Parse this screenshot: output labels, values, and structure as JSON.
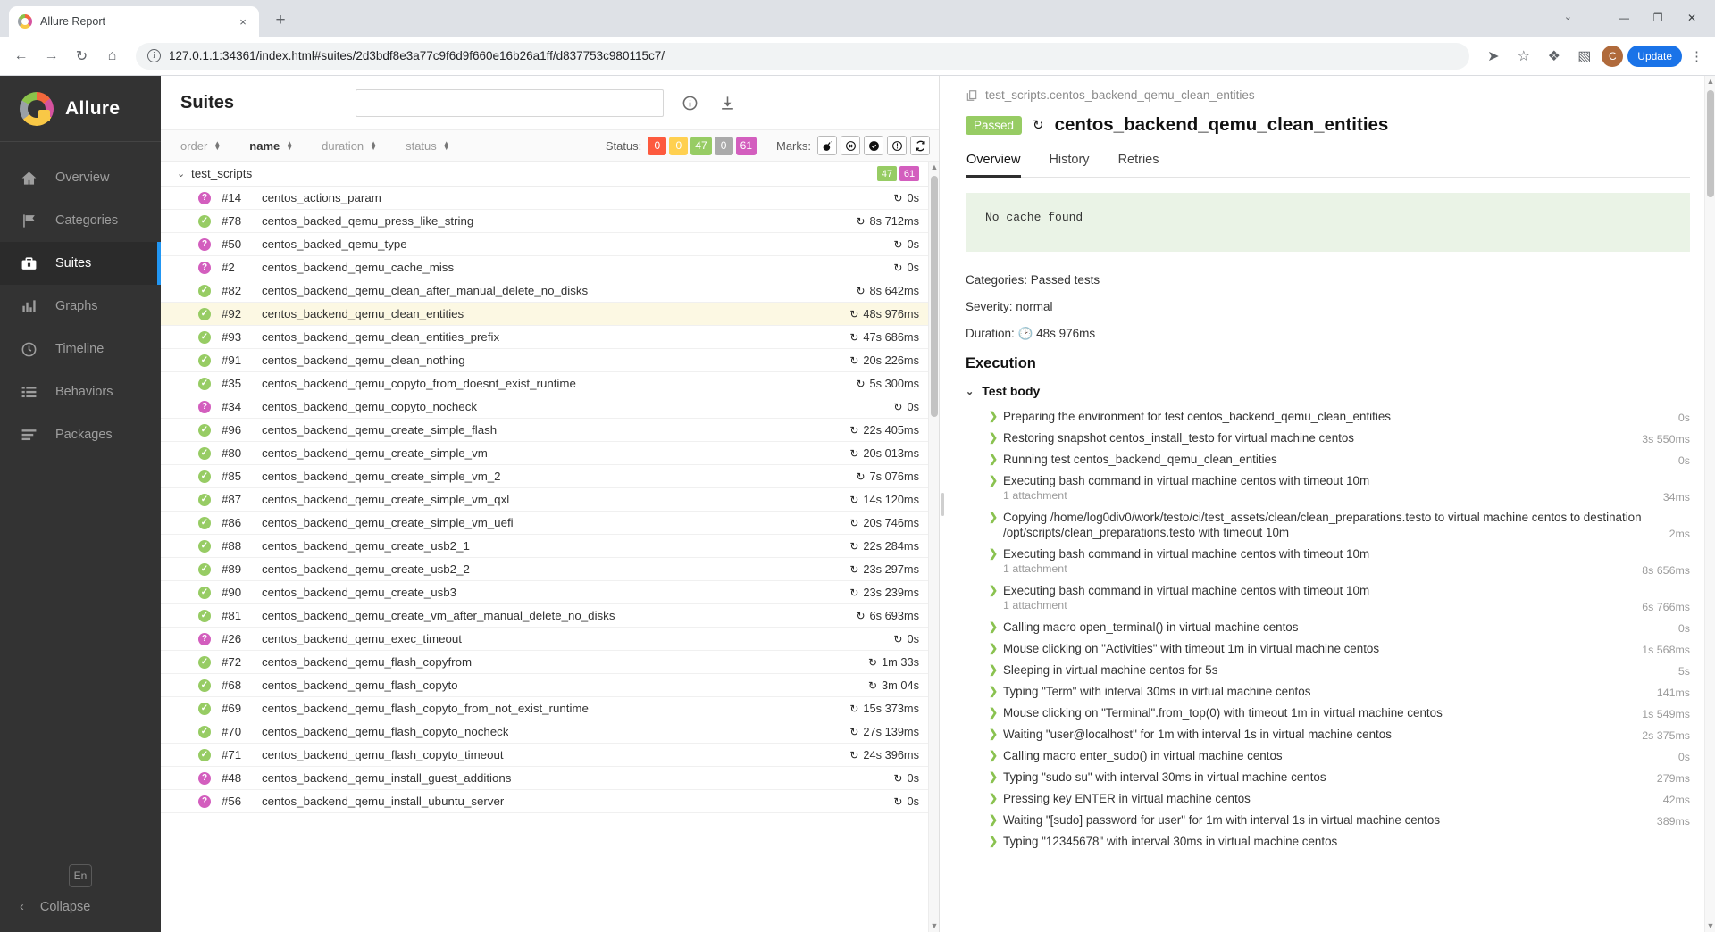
{
  "browser": {
    "tab_title": "Allure Report",
    "tab_close": "×",
    "new_tab": "+",
    "tab_list_chevron": "⌄",
    "url": "127.0.1.1:34361/index.html#suites/2d3bdf8e3a77c9f6d9f660e16b26a1ff/d837753c980115c7/",
    "nav": {
      "back": "←",
      "forward": "→",
      "reload": "↻",
      "home": "⌂",
      "info": "i"
    },
    "right": {
      "share": "➤",
      "bookmark": "☆",
      "extensions": "❖",
      "sidepanel": "▧",
      "profile_initial": "C",
      "update_label": "Update",
      "menu": "⋮"
    },
    "window": {
      "minimize": "—",
      "maximize": "❐",
      "close": "✕"
    }
  },
  "sidebar": {
    "brand": "Allure",
    "items": [
      {
        "label": "Overview",
        "icon": "home-icon",
        "active": false
      },
      {
        "label": "Categories",
        "icon": "flag-icon",
        "active": false
      },
      {
        "label": "Suites",
        "icon": "suitcase-icon",
        "active": true
      },
      {
        "label": "Graphs",
        "icon": "bar-chart-icon",
        "active": false
      },
      {
        "label": "Timeline",
        "icon": "clock-icon",
        "active": false
      },
      {
        "label": "Behaviors",
        "icon": "list-icon",
        "active": false
      },
      {
        "label": "Packages",
        "icon": "layers-icon",
        "active": false
      }
    ],
    "language": "En",
    "collapse": "Collapse",
    "collapse_chevron": "‹"
  },
  "suites": {
    "title": "Suites",
    "search_value": "",
    "search_placeholder": "",
    "info_icon": "info-icon",
    "download_icon": "download-icon",
    "sorters": [
      {
        "label": "order",
        "active": false
      },
      {
        "label": "name",
        "active": true
      },
      {
        "label": "duration",
        "active": false
      },
      {
        "label": "status",
        "active": false
      }
    ],
    "status_label": "Status:",
    "status_chips": [
      {
        "value": "0",
        "color": "#fd5a3e",
        "name": "failed"
      },
      {
        "value": "0",
        "color": "#ffd050",
        "name": "broken"
      },
      {
        "value": "47",
        "color": "#97cc64",
        "name": "passed"
      },
      {
        "value": "0",
        "color": "#aaaaaa",
        "name": "skipped"
      },
      {
        "value": "61",
        "color": "#d35ebe",
        "name": "unknown"
      }
    ],
    "marks_label": "Marks:",
    "marks": [
      {
        "name": "flaky-bomb-icon"
      },
      {
        "name": "new-failed-icon"
      },
      {
        "name": "new-passed-icon"
      },
      {
        "name": "new-broken-icon"
      },
      {
        "name": "retries-icon"
      }
    ],
    "group": {
      "name": "test_scripts",
      "caret": "⌄",
      "chips": [
        {
          "value": "47",
          "color": "#97cc64"
        },
        {
          "value": "61",
          "color": "#d35ebe"
        }
      ]
    },
    "rows": [
      {
        "status": "unknown",
        "num": "#14",
        "name": "centos_actions_param",
        "dur": "0s",
        "retry": true
      },
      {
        "status": "passed",
        "num": "#78",
        "name": "centos_backed_qemu_press_like_string",
        "dur": "8s 712ms",
        "retry": true
      },
      {
        "status": "unknown",
        "num": "#50",
        "name": "centos_backed_qemu_type",
        "dur": "0s",
        "retry": true
      },
      {
        "status": "unknown",
        "num": "#2",
        "name": "centos_backend_qemu_cache_miss",
        "dur": "0s",
        "retry": true
      },
      {
        "status": "passed",
        "num": "#82",
        "name": "centos_backend_qemu_clean_after_manual_delete_no_disks",
        "dur": "8s 642ms",
        "retry": true
      },
      {
        "status": "passed",
        "num": "#92",
        "name": "centos_backend_qemu_clean_entities",
        "dur": "48s 976ms",
        "retry": true,
        "selected": true
      },
      {
        "status": "passed",
        "num": "#93",
        "name": "centos_backend_qemu_clean_entities_prefix",
        "dur": "47s 686ms",
        "retry": true
      },
      {
        "status": "passed",
        "num": "#91",
        "name": "centos_backend_qemu_clean_nothing",
        "dur": "20s 226ms",
        "retry": true
      },
      {
        "status": "passed",
        "num": "#35",
        "name": "centos_backend_qemu_copyto_from_doesnt_exist_runtime",
        "dur": "5s 300ms",
        "retry": true
      },
      {
        "status": "unknown",
        "num": "#34",
        "name": "centos_backend_qemu_copyto_nocheck",
        "dur": "0s",
        "retry": true
      },
      {
        "status": "passed",
        "num": "#96",
        "name": "centos_backend_qemu_create_simple_flash",
        "dur": "22s 405ms",
        "retry": true
      },
      {
        "status": "passed",
        "num": "#80",
        "name": "centos_backend_qemu_create_simple_vm",
        "dur": "20s 013ms",
        "retry": true
      },
      {
        "status": "passed",
        "num": "#85",
        "name": "centos_backend_qemu_create_simple_vm_2",
        "dur": "7s 076ms",
        "retry": true
      },
      {
        "status": "passed",
        "num": "#87",
        "name": "centos_backend_qemu_create_simple_vm_qxl",
        "dur": "14s 120ms",
        "retry": true
      },
      {
        "status": "passed",
        "num": "#86",
        "name": "centos_backend_qemu_create_simple_vm_uefi",
        "dur": "20s 746ms",
        "retry": true
      },
      {
        "status": "passed",
        "num": "#88",
        "name": "centos_backend_qemu_create_usb2_1",
        "dur": "22s 284ms",
        "retry": true
      },
      {
        "status": "passed",
        "num": "#89",
        "name": "centos_backend_qemu_create_usb2_2",
        "dur": "23s 297ms",
        "retry": true
      },
      {
        "status": "passed",
        "num": "#90",
        "name": "centos_backend_qemu_create_usb3",
        "dur": "23s 239ms",
        "retry": true
      },
      {
        "status": "passed",
        "num": "#81",
        "name": "centos_backend_qemu_create_vm_after_manual_delete_no_disks",
        "dur": "6s 693ms",
        "retry": true
      },
      {
        "status": "unknown",
        "num": "#26",
        "name": "centos_backend_qemu_exec_timeout",
        "dur": "0s",
        "retry": true
      },
      {
        "status": "passed",
        "num": "#72",
        "name": "centos_backend_qemu_flash_copyfrom",
        "dur": "1m 33s",
        "retry": true
      },
      {
        "status": "passed",
        "num": "#68",
        "name": "centos_backend_qemu_flash_copyto",
        "dur": "3m 04s",
        "retry": true
      },
      {
        "status": "passed",
        "num": "#69",
        "name": "centos_backend_qemu_flash_copyto_from_not_exist_runtime",
        "dur": "15s 373ms",
        "retry": true
      },
      {
        "status": "passed",
        "num": "#70",
        "name": "centos_backend_qemu_flash_copyto_nocheck",
        "dur": "27s 139ms",
        "retry": true
      },
      {
        "status": "passed",
        "num": "#71",
        "name": "centos_backend_qemu_flash_copyto_timeout",
        "dur": "24s 396ms",
        "retry": true
      },
      {
        "status": "unknown",
        "num": "#48",
        "name": "centos_backend_qemu_install_guest_additions",
        "dur": "0s",
        "retry": true
      },
      {
        "status": "unknown",
        "num": "#56",
        "name": "centos_backend_qemu_install_ubuntu_server",
        "dur": "0s",
        "retry": true
      }
    ],
    "scroll_up": "▲",
    "scroll_down": "▼"
  },
  "detail": {
    "breadcrumb": "test_scripts.centos_backend_qemu_clean_entities",
    "breadcrumb_icon": "copy-icon",
    "status_badge": "Passed",
    "retry_icon": "retries-icon",
    "test_name": "centos_backend_qemu_clean_entities",
    "tabs": [
      {
        "label": "Overview",
        "active": true
      },
      {
        "label": "History",
        "active": false
      },
      {
        "label": "Retries",
        "active": false
      }
    ],
    "cache_message": "No cache found",
    "categories": "Categories: Passed tests",
    "severity": "Severity: normal",
    "duration_label": "Duration:",
    "duration_icon": "clock-icon",
    "duration_value": "48s 976ms",
    "execution_heading": "Execution",
    "test_body_heading": "Test body",
    "test_body_caret": "⌄",
    "steps": [
      {
        "text": "Preparing the environment for test centos_backend_qemu_clean_entities",
        "attachment": "",
        "duration": "0s"
      },
      {
        "text": "Restoring snapshot centos_install_testo for virtual machine centos",
        "attachment": "",
        "duration": "3s 550ms"
      },
      {
        "text": "Running test centos_backend_qemu_clean_entities",
        "attachment": "",
        "duration": "0s"
      },
      {
        "text": "Executing bash command in virtual machine centos with timeout 10m",
        "attachment": "1 attachment",
        "duration": "34ms"
      },
      {
        "text": "Copying /home/log0div0/work/testo/ci/test_assets/clean/clean_preparations.testo to virtual machine centos to destination /opt/scripts/clean_preparations.testo with timeout 10m",
        "attachment": "",
        "duration": "2ms"
      },
      {
        "text": "Executing bash command in virtual machine centos with timeout 10m",
        "attachment": "1 attachment",
        "duration": "8s 656ms"
      },
      {
        "text": "Executing bash command in virtual machine centos with timeout 10m",
        "attachment": "1 attachment",
        "duration": "6s 766ms"
      },
      {
        "text": "Calling macro open_terminal() in virtual machine centos",
        "attachment": "",
        "duration": "0s"
      },
      {
        "text": "Mouse clicking on \"Activities\" with timeout 1m in virtual machine centos",
        "attachment": "",
        "duration": "1s 568ms"
      },
      {
        "text": "Sleeping in virtual machine centos for 5s",
        "attachment": "",
        "duration": "5s"
      },
      {
        "text": "Typing \"Term\" with interval 30ms in virtual machine centos",
        "attachment": "",
        "duration": "141ms"
      },
      {
        "text": "Mouse clicking on \"Terminal\".from_top(0) with timeout 1m in virtual machine centos",
        "attachment": "",
        "duration": "1s 549ms"
      },
      {
        "text": "Waiting \"user@localhost\" for 1m with interval 1s in virtual machine centos",
        "attachment": "",
        "duration": "2s 375ms"
      },
      {
        "text": "Calling macro enter_sudo() in virtual machine centos",
        "attachment": "",
        "duration": "0s"
      },
      {
        "text": "Typing \"sudo su\" with interval 30ms in virtual machine centos",
        "attachment": "",
        "duration": "279ms"
      },
      {
        "text": "Pressing key ENTER in virtual machine centos",
        "attachment": "",
        "duration": "42ms"
      },
      {
        "text": "Waiting \"[sudo] password for user\" for 1m with interval 1s in virtual machine centos",
        "attachment": "",
        "duration": "389ms"
      },
      {
        "text": "Typing \"12345678\" with interval 30ms in virtual machine centos",
        "attachment": "",
        "duration": ""
      }
    ]
  }
}
